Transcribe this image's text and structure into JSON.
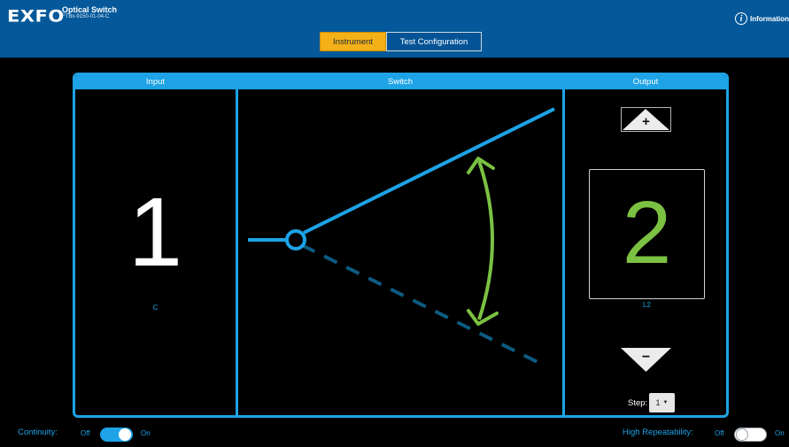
{
  "header": {
    "logo": "EXFO",
    "app_title": "Optical Switch",
    "app_subtitle": "FTBx-9150-01-04-C",
    "info_label": "Information",
    "info_icon": "info-circle-icon"
  },
  "tabs": [
    {
      "label": "Instrument",
      "active": true
    },
    {
      "label": "Test Configuration",
      "active": false
    }
  ],
  "panel": {
    "input": {
      "heading": "Input",
      "value": "1",
      "sublabel": "C"
    },
    "switch": {
      "heading": "Switch"
    },
    "output": {
      "heading": "Output",
      "value": "2",
      "sublabel": "L2",
      "increase_symbol": "+",
      "decrease_symbol": "−",
      "step_label": "Step:",
      "step_value": "1"
    }
  },
  "footer": {
    "continuity": {
      "label": "Continuity:",
      "off": "Off",
      "on": "On",
      "state": "on"
    },
    "high_repeatability": {
      "label": "High Repeatability:",
      "off": "Off",
      "on": "On",
      "state": "off"
    }
  },
  "colors": {
    "header_bg": "#05599a",
    "accent_blue": "#1da3e6",
    "active_tab": "#f4b017",
    "output_green": "#7bc142",
    "arrow_green": "#7bc142",
    "dashed_line": "#0d5b80"
  }
}
